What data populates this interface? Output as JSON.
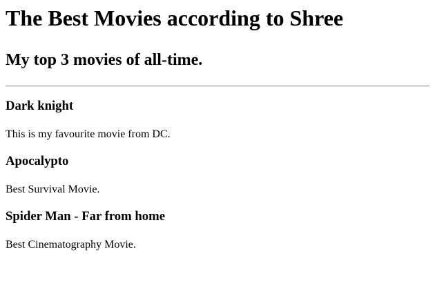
{
  "title": "The Best Movies according to Shree",
  "subtitle": "My top 3 movies of all-time.",
  "movies": [
    {
      "name": "Dark knight",
      "description": "This is my favourite movie from DC."
    },
    {
      "name": "Apocalypto",
      "description": "Best Survival Movie."
    },
    {
      "name": "Spider Man - Far from home",
      "description": "Best Cinematography Movie."
    }
  ]
}
